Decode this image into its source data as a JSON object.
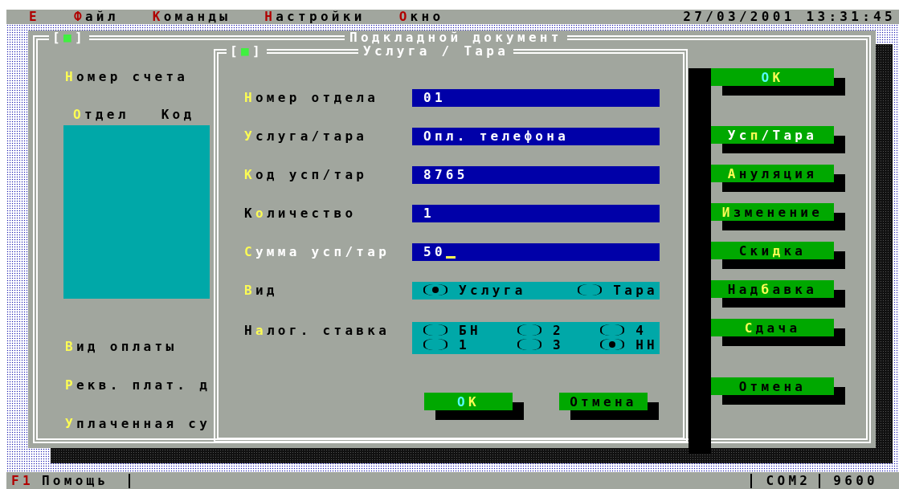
{
  "menu": [
    {
      "key": "Е"
    },
    {
      "key": "Ф",
      "post": "айл"
    },
    {
      "key": "К",
      "post": "оманды"
    },
    {
      "key": "Н",
      "post": "астройки"
    },
    {
      "key": "О",
      "post": "кно"
    }
  ],
  "clock": "27/03/2001 13:31:45",
  "window": {
    "title": "Подкладной документ",
    "close": {
      "left": "[",
      "mark": "■",
      "right": "]"
    },
    "top_fields": [
      {
        "key": "Н",
        "post": "омер счета"
      }
    ],
    "list_columns": [
      {
        "key": "О",
        "post": "тдел"
      },
      {
        "pre": "Код"
      }
    ],
    "bottom_fields": [
      {
        "key": "В",
        "post": "ид оплаты"
      },
      {
        "key": "Р",
        "post": "екв. плат. д"
      },
      {
        "key": "У",
        "post": "плаченная су"
      }
    ]
  },
  "dialog": {
    "title": "Услуга / Тара",
    "close": {
      "left": "[",
      "mark": "■",
      "right": "]"
    },
    "fields": [
      {
        "kind": "text",
        "label": {
          "key": "Н",
          "post": "омер отдела"
        },
        "value": "01",
        "focused": false
      },
      {
        "kind": "text",
        "label": {
          "key": "У",
          "post": "слуга/тара"
        },
        "value": "Опл. телефона",
        "focused": false
      },
      {
        "kind": "text",
        "label": {
          "key": "К",
          "post": "од усп/тар"
        },
        "value": "8765",
        "focused": false
      },
      {
        "kind": "text",
        "label": {
          "pre": "К",
          "key": "о",
          "post": "личество"
        },
        "value": "1",
        "focused": false
      },
      {
        "kind": "text",
        "label": {
          "key": "С",
          "post": "умма усп/тар"
        },
        "value": "50",
        "focused": true
      },
      {
        "kind": "radio",
        "label": {
          "key": "В",
          "post": "ид"
        },
        "rows": [
          [
            {
              "label": "Услуга",
              "selected": true
            },
            {
              "label": "Тара",
              "selected": false
            }
          ]
        ]
      },
      {
        "kind": "radio",
        "label": {
          "pre": "Н",
          "key": "а",
          "post": "лог. ставка"
        },
        "rows": [
          [
            {
              "label": "БН",
              "selected": false
            },
            {
              "label": "2",
              "selected": false
            },
            {
              "label": "4",
              "selected": false
            }
          ],
          [
            {
              "label": "1",
              "selected": false
            },
            {
              "label": "3",
              "selected": false
            },
            {
              "label": "НН",
              "selected": true
            }
          ]
        ]
      }
    ],
    "buttons": [
      {
        "pre": "О",
        "key": "К",
        "default": true,
        "focused": false
      },
      {
        "pre": "Отмена",
        "default": false,
        "focused": false
      }
    ]
  },
  "side_buttons": [
    {
      "pre": "О",
      "key": "К",
      "default": true,
      "focused": false
    },
    {
      "pre": "Ус",
      "key": "п",
      "post": "/Тара",
      "default": false,
      "focused": true
    },
    {
      "key": "А",
      "post": "нуляция",
      "default": false,
      "focused": false
    },
    {
      "key": "И",
      "post": "зменение",
      "default": false,
      "focused": false
    },
    {
      "pre": "Ски",
      "key": "д",
      "post": "ка",
      "default": false,
      "focused": false
    },
    {
      "pre": "Над",
      "key": "б",
      "post": "авка",
      "default": false,
      "focused": false
    },
    {
      "key": "С",
      "post": "дача",
      "default": false,
      "focused": false
    },
    {
      "pre": "Отмена",
      "default": false,
      "focused": false
    }
  ],
  "status_bar": {
    "key": "F1",
    "help": "Помощь",
    "port": "COM2",
    "baud": "9600"
  }
}
